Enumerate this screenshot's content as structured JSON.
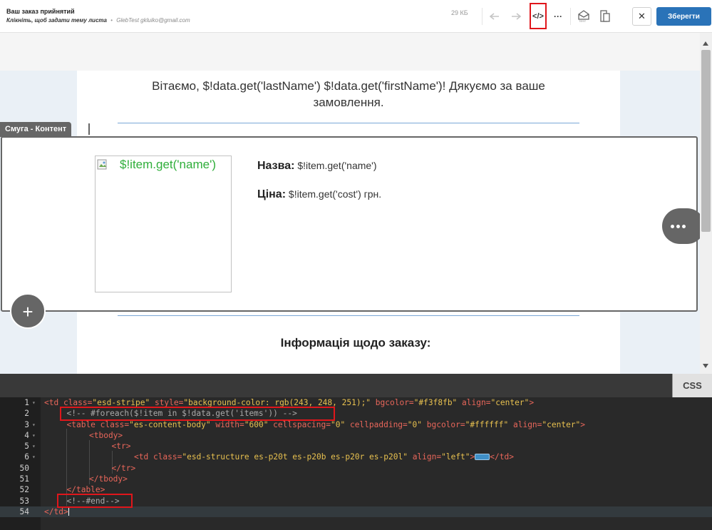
{
  "header": {
    "subject": "Ваш заказ прийнятий",
    "topic_placeholder": "Клікніть, щоб задати тему листа",
    "separator": "•",
    "sender": "GlebTest gkluiko@gmail.com",
    "size": "29 КБ",
    "test_label": "TEST",
    "close_label": "✕",
    "save_label": "Зберегти",
    "code_label": "</>",
    "more_label": "···"
  },
  "editor": {
    "greeting": "Вітаємо, $!data.get('lastName') $!data.get('firstName')! Дякуємо за ваше замовлення.",
    "stripe_label": "Смуга - Контент",
    "image_alt": "$!item.get('name')",
    "name_label": "Назва:",
    "name_value": "$!item.get('name')",
    "price_label": "Ціна:",
    "price_value": "$!item.get('cost') грн.",
    "add_label": "+",
    "info_title": "Інформація щодо заказу:"
  },
  "code_editor": {
    "tab_label": "CSS",
    "lines": [
      {
        "num": "1",
        "fold": true,
        "tokens": [
          [
            "t-tag",
            "<td "
          ],
          [
            "t-attr",
            "class="
          ],
          [
            "t-val",
            "\"esd-stripe\" "
          ],
          [
            "t-attr",
            "style="
          ],
          [
            "t-val",
            "\"background-color: rgb(243, 248, 251);\" "
          ],
          [
            "t-attr",
            "bgcolor="
          ],
          [
            "t-val",
            "\"#f3f8fb\" "
          ],
          [
            "t-attr",
            "align="
          ],
          [
            "t-val",
            "\"center\""
          ],
          [
            "t-tag",
            ">"
          ]
        ],
        "indent": 0
      },
      {
        "num": "2",
        "fold": false,
        "tokens": [
          [
            "t-com",
            "<!-- #foreach($!item in $!data.get('items')) -->"
          ]
        ],
        "indent": 1
      },
      {
        "num": "3",
        "fold": true,
        "tokens": [
          [
            "t-tag",
            "<table "
          ],
          [
            "t-attr",
            "class="
          ],
          [
            "t-val",
            "\"es-content-body\" "
          ],
          [
            "t-attr",
            "width="
          ],
          [
            "t-val",
            "\"600\" "
          ],
          [
            "t-attr",
            "cellspacing="
          ],
          [
            "t-val",
            "\"0\" "
          ],
          [
            "t-attr",
            "cellpadding="
          ],
          [
            "t-val",
            "\"0\" "
          ],
          [
            "t-attr",
            "bgcolor="
          ],
          [
            "t-val",
            "\"#ffffff\" "
          ],
          [
            "t-attr",
            "align="
          ],
          [
            "t-val",
            "\"center\""
          ],
          [
            "t-tag",
            ">"
          ]
        ],
        "indent": 1
      },
      {
        "num": "4",
        "fold": true,
        "tokens": [
          [
            "t-tag",
            "<tbody>"
          ]
        ],
        "indent": 2
      },
      {
        "num": "5",
        "fold": true,
        "tokens": [
          [
            "t-tag",
            "<tr>"
          ]
        ],
        "indent": 3
      },
      {
        "num": "6",
        "fold": true,
        "tokens": [
          [
            "t-tag",
            "<td "
          ],
          [
            "t-attr",
            "class="
          ],
          [
            "t-val",
            "\"esd-structure es-p20t es-p20b es-p20r es-p20l\" "
          ],
          [
            "t-attr",
            "align="
          ],
          [
            "t-val",
            "\"left\""
          ],
          [
            "t-tag",
            ">"
          ],
          [
            "fold-marker",
            ""
          ],
          [
            "t-tag",
            "</td>"
          ]
        ],
        "indent": 4
      },
      {
        "num": "50",
        "fold": false,
        "tokens": [
          [
            "t-tag",
            "</tr>"
          ]
        ],
        "indent": 3
      },
      {
        "num": "51",
        "fold": false,
        "tokens": [
          [
            "t-tag",
            "</tbody>"
          ]
        ],
        "indent": 2
      },
      {
        "num": "52",
        "fold": false,
        "tokens": [
          [
            "t-tag",
            "</table>"
          ]
        ],
        "indent": 1
      },
      {
        "num": "53",
        "fold": false,
        "tokens": [
          [
            "t-com",
            "<!--#end-->"
          ]
        ],
        "indent": 1
      },
      {
        "num": "54",
        "fold": false,
        "tokens": [
          [
            "t-tag",
            "</td>"
          ],
          [
            "cursor",
            ""
          ]
        ],
        "indent": 0,
        "active": true
      }
    ]
  },
  "colors": {
    "accent_blue": "#2a73b8",
    "highlight_red": "#e0161b",
    "link_green": "#2fae3a"
  }
}
